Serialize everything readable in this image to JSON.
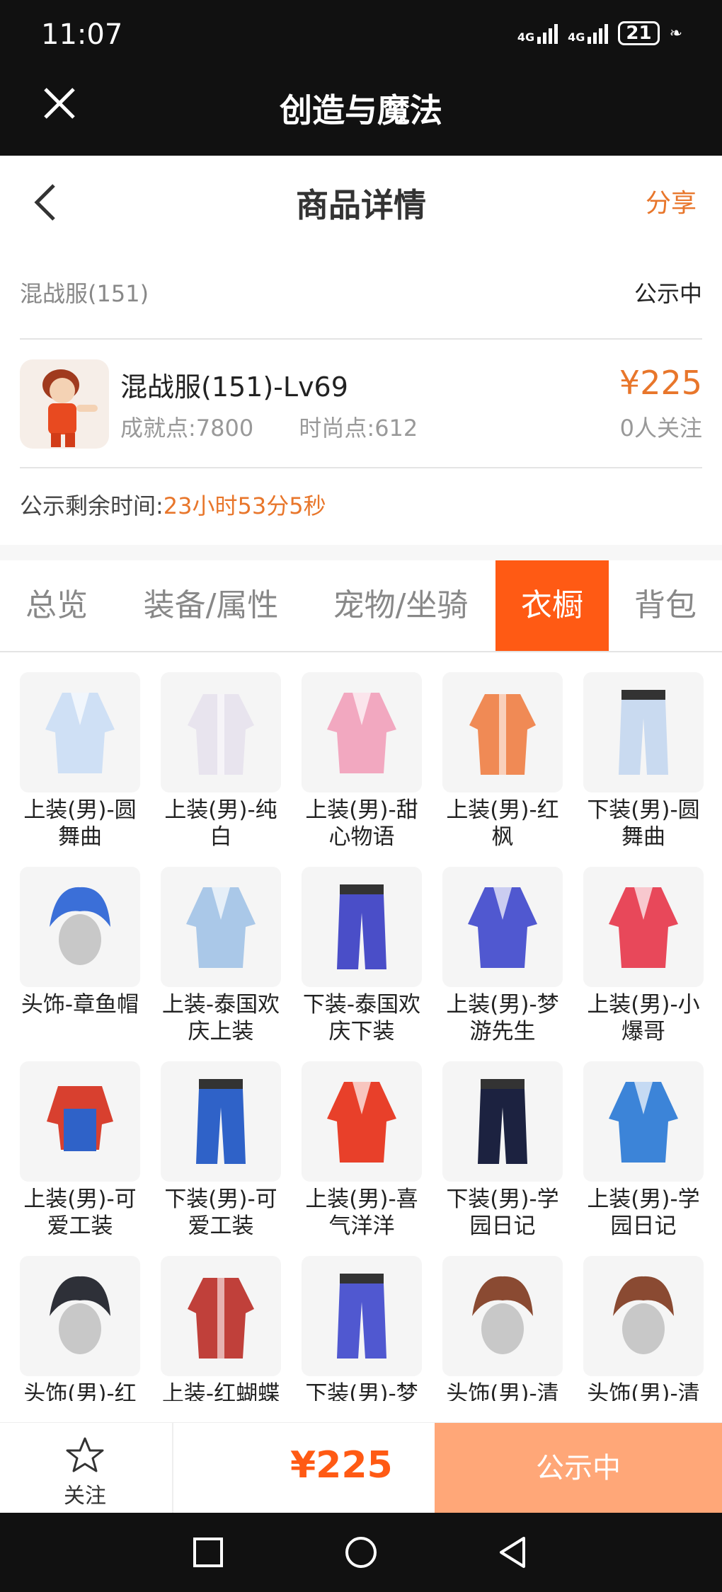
{
  "status_bar": {
    "time": "11:07",
    "net1": "4G",
    "net2": "4G",
    "battery": "21"
  },
  "app_bar": {
    "title": "创造与魔法"
  },
  "nav": {
    "title": "商品详情",
    "share": "分享"
  },
  "server_row": {
    "name": "混战服(151)",
    "status": "公示中"
  },
  "item": {
    "name": "混战服(151)-Lv69",
    "achievement": "成就点:7800",
    "fashion": "时尚点:612",
    "price": "¥225",
    "followers": "0人关注"
  },
  "countdown": {
    "label": "公示剩余时间:",
    "value": "23小时53分5秒"
  },
  "tabs": [
    {
      "label": "总览"
    },
    {
      "label": "装备/属性"
    },
    {
      "label": "宠物/坐骑"
    },
    {
      "label": "衣橱",
      "active": true
    },
    {
      "label": "背包"
    }
  ],
  "wardrobe": [
    {
      "label": "上装(男)-圆舞曲",
      "icon": "jacket-icon",
      "color": "#cfe0f5"
    },
    {
      "label": "上装(男)-纯白",
      "icon": "coat-icon",
      "color": "#e8e4ee"
    },
    {
      "label": "上装(男)-甜心物语",
      "icon": "jacket-icon",
      "color": "#f2a8c0"
    },
    {
      "label": "上装(男)-红枫",
      "icon": "robe-icon",
      "color": "#f08a55"
    },
    {
      "label": "下装(男)-圆舞曲",
      "icon": "pants-icon",
      "color": "#c9daf0"
    },
    {
      "label": "头饰-章鱼帽",
      "icon": "hat-icon",
      "color": "#3b6fd8"
    },
    {
      "label": "上装-泰国欢庆上装",
      "icon": "jacket-icon",
      "color": "#aac8e8"
    },
    {
      "label": "下装-泰国欢庆下装",
      "icon": "pants-icon",
      "color": "#4a4ec8"
    },
    {
      "label": "上装(男)-梦游先生",
      "icon": "pajama-icon",
      "color": "#5058d0"
    },
    {
      "label": "上装(男)-小爆哥",
      "icon": "hoodie-icon",
      "color": "#e8485a"
    },
    {
      "label": "上装(男)-可爱工装",
      "icon": "overalls-icon",
      "color": "#d8402f"
    },
    {
      "label": "下装(男)-可爱工装",
      "icon": "pants-icon",
      "color": "#2f62c8"
    },
    {
      "label": "上装(男)-喜气洋洋",
      "icon": "jacket-icon",
      "color": "#e8402a"
    },
    {
      "label": "下装(男)-学园日记",
      "icon": "pants-icon",
      "color": "#1c2240"
    },
    {
      "label": "上装(男)-学园日记",
      "icon": "jacket-icon",
      "color": "#3c84d8"
    },
    {
      "label": "头饰(男)-红枫",
      "icon": "hair-icon",
      "color": "#2e3038"
    },
    {
      "label": "上装-红蝴蝶衣",
      "icon": "coat-icon",
      "color": "#c0403a"
    },
    {
      "label": "下装(男)-梦游先生",
      "icon": "pants-icon",
      "color": "#5058d0"
    },
    {
      "label": "头饰(男)-清新短发",
      "icon": "hair-icon",
      "color": "#8a4a32"
    },
    {
      "label": "头饰(男)-清新短发",
      "icon": "hair-icon",
      "color": "#8a4a32"
    }
  ],
  "bottom_bar": {
    "follow": "关注",
    "price": "¥225",
    "cta": "公示中"
  },
  "colors": {
    "accent": "#e8762b",
    "active_tab": "#ff5a14",
    "cta": "#ffa778"
  }
}
